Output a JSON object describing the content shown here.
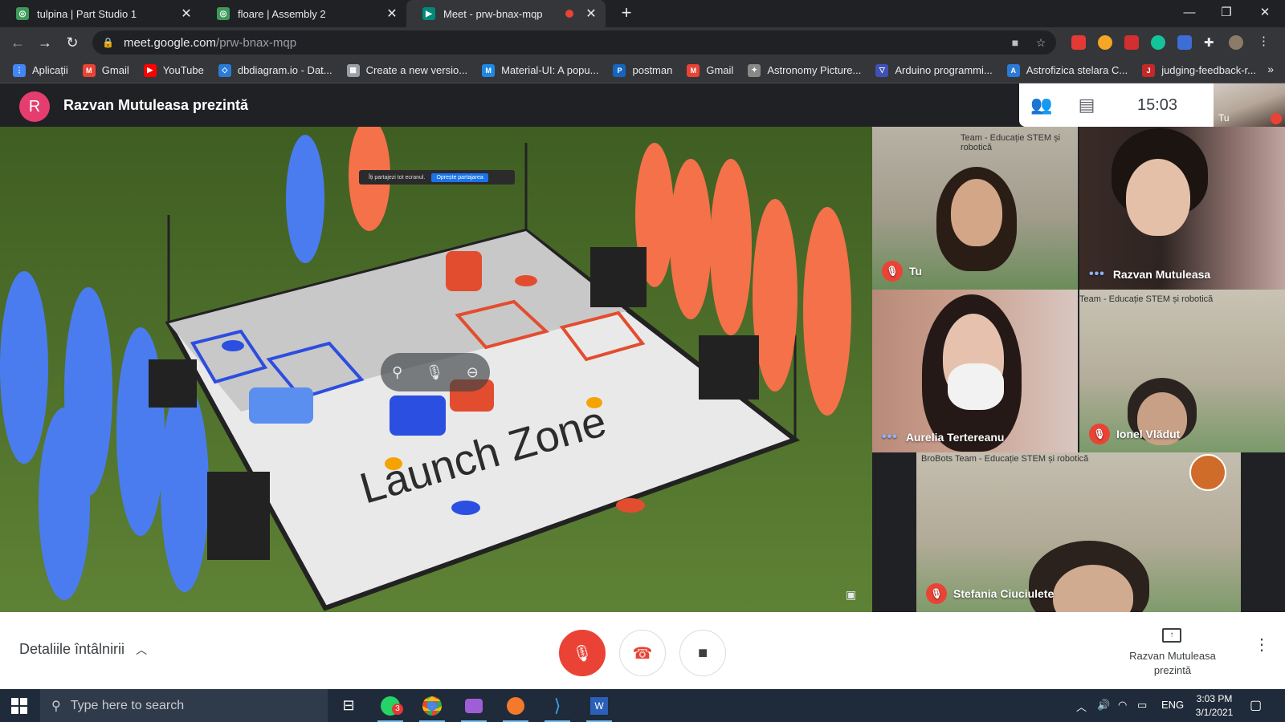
{
  "tabs": [
    {
      "title": "tulpina | Part Studio 1",
      "icon": "onshape-icon"
    },
    {
      "title": "floare | Assembly 2",
      "icon": "onshape-icon"
    },
    {
      "title": "Meet - prw-bnax-mqp",
      "icon": "google-meet-icon",
      "recording": true
    }
  ],
  "address": {
    "host": "meet.google.com",
    "path": "/prw-bnax-mqp"
  },
  "bookmarks": [
    {
      "label": "Aplicații",
      "icon": "apps-grid-icon",
      "color": "#4285f4"
    },
    {
      "label": "Gmail",
      "icon": "gmail-icon",
      "color": "#ea4335"
    },
    {
      "label": "YouTube",
      "icon": "youtube-icon",
      "color": "#ff0000"
    },
    {
      "label": "dbdiagram.io - Dat...",
      "icon": "dbdiagram-icon",
      "color": "#2a7bd8"
    },
    {
      "label": "Create a new versio...",
      "icon": "page-icon",
      "color": "#9aa0a6"
    },
    {
      "label": "Material-UI: A popu...",
      "icon": "material-ui-icon",
      "color": "#1e88e5"
    },
    {
      "label": "postman",
      "icon": "postman-icon",
      "color": "#1565c0"
    },
    {
      "label": "Gmail",
      "icon": "gmail-icon",
      "color": "#ea4335"
    },
    {
      "label": "Astronomy Picture...",
      "icon": "astronomy-icon",
      "color": "#888888"
    },
    {
      "label": "Arduino programmi...",
      "icon": "arduino-icon",
      "color": "#3f51b5"
    },
    {
      "label": "Astrofizica stelara C...",
      "icon": "astro-icon",
      "color": "#2a7bd8"
    },
    {
      "label": "judging-feedback-r...",
      "icon": "judging-icon",
      "color": "#c62828"
    }
  ],
  "meet": {
    "presenter_initial": "R",
    "presenter_title": "Razvan Mutuleasa prezintă",
    "clock": "15:03",
    "self_label": "Tu",
    "share_bar_text": "Îți partajezi tot ecranul.",
    "share_bar_stop": "Oprește partajarea",
    "field_label": "Launch Zone",
    "participants": [
      {
        "name": "Tu",
        "muted": true,
        "banner": "Team - Educație STEM și robotică"
      },
      {
        "name": "Razvan Mutuleasa",
        "muted": false,
        "banner": ""
      },
      {
        "name": "Aurelia Tertereanu",
        "muted": false,
        "banner": ""
      },
      {
        "name": "Ionel Vlădut",
        "muted": true,
        "banner": "Team - Educație STEM și robotică"
      },
      {
        "name": "Stefania Ciuciulete",
        "muted": true,
        "banner": "BroBots Team - Educație STEM și robotică"
      }
    ],
    "details_label": "Detaliile întâlnirii",
    "presenting_label": "Razvan Mutuleasa prezintă"
  },
  "taskbar": {
    "search_placeholder": "Type here to search",
    "whatsapp_badge": "3",
    "lang": "ENG",
    "time": "3:03 PM",
    "date": "3/1/2021"
  }
}
